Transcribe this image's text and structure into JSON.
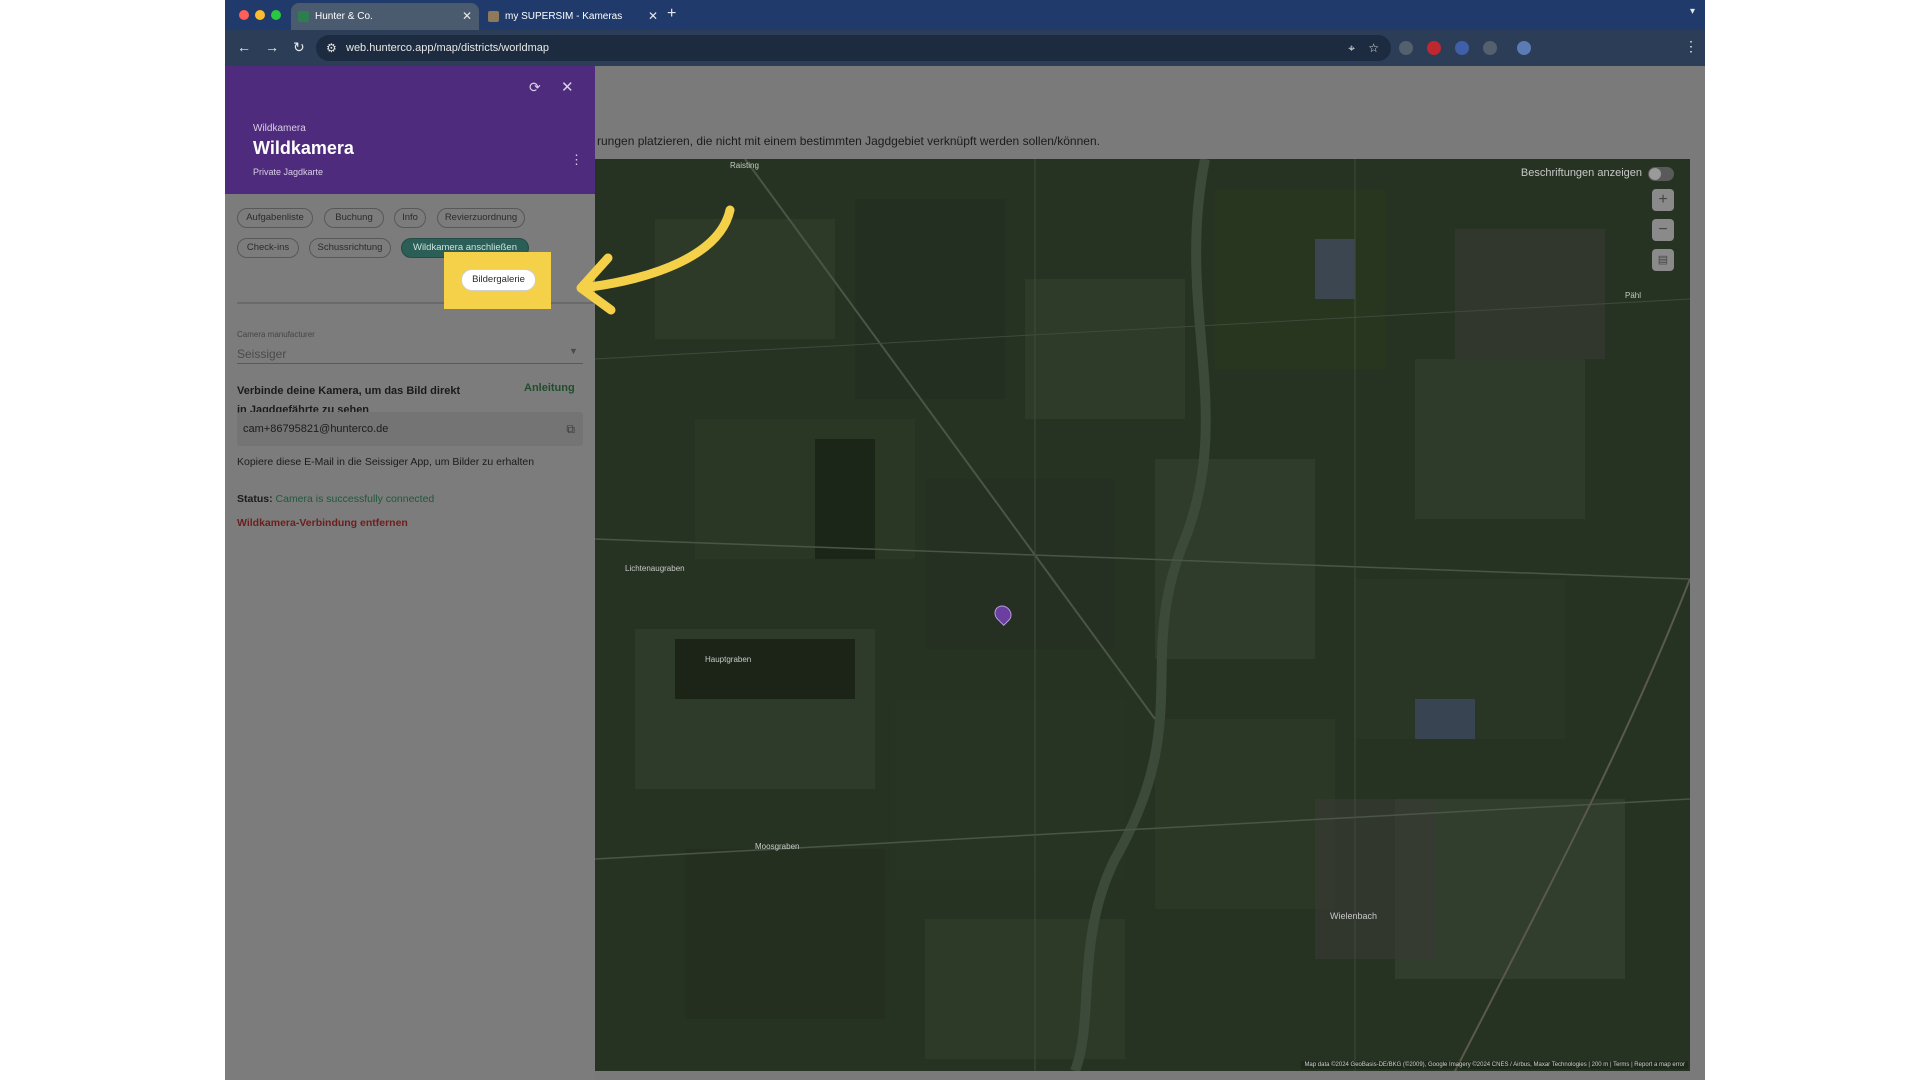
{
  "browser": {
    "tabs": [
      {
        "label": "Hunter & Co.",
        "active": true
      },
      {
        "label": "my SUPERSIM - Kameras",
        "active": false
      }
    ],
    "new_tab": "+",
    "url": "web.hunterco.app/map/districts/worldmap"
  },
  "page": {
    "help_text": "rungen platzieren, die nicht mit einem bestimmten Jagdgebiet verknüpft werden sollen/können."
  },
  "panel": {
    "type_label": "Wildkamera",
    "title": "Wildkamera",
    "subtitle": "Private Jagdkarte",
    "tabs": [
      "Aufgabenliste",
      "Buchung",
      "Info",
      "Revierzuordnung",
      "Check-ins",
      "Schussrichtung",
      "Wildkamera anschließen",
      "Bildergalerie"
    ],
    "active_tab": "Wildkamera anschließen",
    "highlighted_tab": "Bildergalerie",
    "manufacturer_label": "Camera manufacturer",
    "manufacturer_value": "Seissiger",
    "connect_text": "Verbinde deine Kamera, um das Bild direkt in Jagdgefährte zu sehen",
    "anleitung": "Anleitung",
    "email": "cam+86795821@hunterco.de",
    "copy_hint": "Kopiere diese E-Mail in die Seissiger App, um Bilder zu erhalten",
    "status_label": "Status:",
    "status_value": "Camera is successfully connected",
    "remove_link": "Wildkamera-Verbindung entfernen"
  },
  "map": {
    "labels_toggle": "Beschriftungen anzeigen",
    "place_labels": [
      "Raisting",
      "Wielenbach",
      "Pähl",
      "Hauptgraben",
      "Lichtenaugraben",
      "Moosgraben"
    ],
    "attribution": "Map data ©2024 GeoBasis-DE/BKG (©2009), Google Imagery ©2024 CNES / Airbus, Maxar Technologies | 200 m | Terms | Report a map error"
  },
  "colors": {
    "panel_header": "#4f2b7d",
    "active_chip": "#2b5e56",
    "status_ok": "#1f5a3a",
    "danger": "#6e1d1d",
    "highlight": "#f5d14a"
  }
}
